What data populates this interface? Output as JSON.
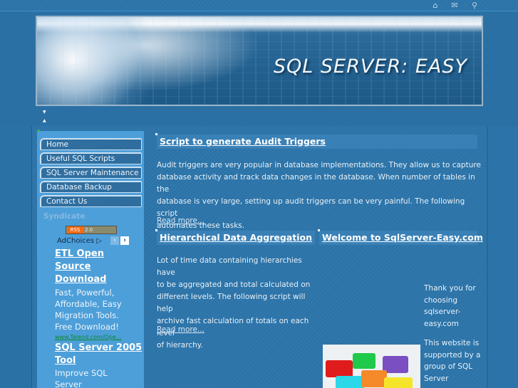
{
  "topbar": {
    "icons": [
      {
        "name": "home-icon",
        "glyph": "⌂"
      },
      {
        "name": "mail-icon",
        "glyph": "✉"
      },
      {
        "name": "search-icon",
        "glyph": "⚲"
      }
    ]
  },
  "banner": {
    "title": "SQL SERVER: EASY"
  },
  "toggles": {
    "collapse": "▼",
    "expand": "▲"
  },
  "sidebar": {
    "nav": [
      {
        "label": "Home"
      },
      {
        "label": "Useful SQL Scripts"
      },
      {
        "label": "SQL Server Maintenance"
      },
      {
        "label": "Database Backup"
      },
      {
        "label": "Contact Us"
      }
    ],
    "syndicate_label": "Syndicate",
    "rss": {
      "left": "RSS",
      "right": "2.0"
    },
    "adchoices": "AdChoices ▷",
    "ad_prev": "‹",
    "ad_next": "›",
    "ads": [
      {
        "title_lines": [
          "ETL Open",
          "Source",
          "Download"
        ],
        "text_lines": [
          "Fast, Powerful,",
          "Affordable, Easy",
          "Migration Tools.",
          "Free Download!"
        ],
        "url": "www.Talend.com/Ope..."
      },
      {
        "title_lines": [
          "SQL Server 2005",
          "Tool"
        ],
        "text_lines": [
          "Improve SQL",
          "Server"
        ]
      }
    ]
  },
  "articles": {
    "audit": {
      "title": "Script to generate Audit Triggers",
      "lines": [
        "Audit triggers are very popular in database implementations. They allow us to capture",
        "database activity and track data changes in the database. When number of tables in the",
        "database is very large, setting up audit triggers can be very painful. The following script",
        "automates these tasks."
      ],
      "read_more": "Read more..."
    },
    "hierarchy": {
      "title": "Hierarchical Data Aggregation",
      "lines": [
        "Lot of time data containing hierarchies have",
        "to be aggregated and total calculated on",
        "different levels. The following script will help",
        "archive fast calculation of totals on each level",
        "of hierarchy."
      ],
      "read_more": "Read more..."
    },
    "welcome": {
      "title": "Welcome to SqlServer-Easy.com",
      "lines1": [
        "Thank you for",
        "choosing",
        "sqlserver-",
        "easy.com"
      ],
      "lines2": [
        "This website is",
        "supported by a",
        "group of SQL",
        "Server"
      ]
    }
  }
}
